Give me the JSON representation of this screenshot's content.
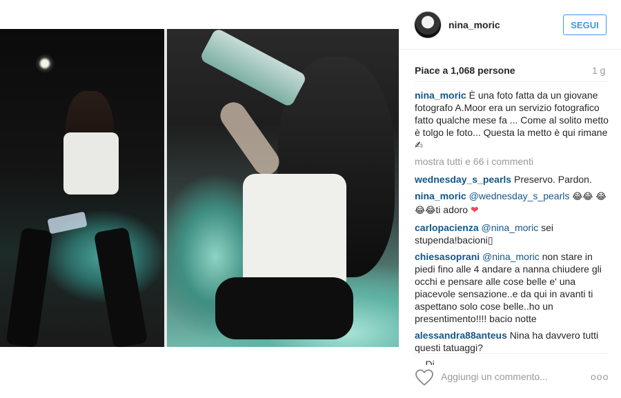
{
  "post": {
    "username": "nina_moric",
    "follow_label": "SEGUI",
    "likes_prefix": "Piace a ",
    "likes_count": "1,068",
    "likes_suffix": " persone",
    "time_ago": "1 g"
  },
  "caption": {
    "user": "nina_moric",
    "text": "È una foto fatta da un giovane fotografo A.Moor era un servizio fotografico fatto qualche mese fa ... Come al solito metto è tolgo le foto... Questa la metto è qui rimane ✍"
  },
  "show_all_comments": "mostra tutti e 66 i commenti",
  "comments": [
    {
      "user": "wednesday_s_pearls",
      "text": "Preservo. Pardon."
    },
    {
      "user": "nina_moric",
      "mention": "@wednesday_s_pearls",
      "emoji1": "😂😂",
      "emoji2": "😂😂😂",
      "text": "ti adoro",
      "heart": "❤"
    },
    {
      "user": "carlopacienza",
      "mention": "@nina_moric",
      "text": "sei stupenda!bacioni▯"
    },
    {
      "user": "chiesasoprani",
      "mention": "@nina_moric",
      "text": "non stare in piedi fino alle 4 andare a nanna chiudere gli occhi e pensare alle cose belle e' una piacevole sensazione..e da qui in avanti ti aspettano solo cose belle..ho un presentimento!!!! bacio notte"
    },
    {
      "user": "alessandra88anteus",
      "text": "Nina ha davvero tutti questi tatuaggi?"
    }
  ],
  "cut_comment": "       ...   Di ...   ...",
  "footer": {
    "add_comment_placeholder": "Aggiungi un commento...",
    "more_label": "ooo"
  },
  "icons": {
    "like": "heart-outline-icon",
    "more": "more-options-icon"
  },
  "colors": {
    "link_blue": "#125688",
    "button_blue": "#3897f0",
    "muted": "#999999"
  }
}
